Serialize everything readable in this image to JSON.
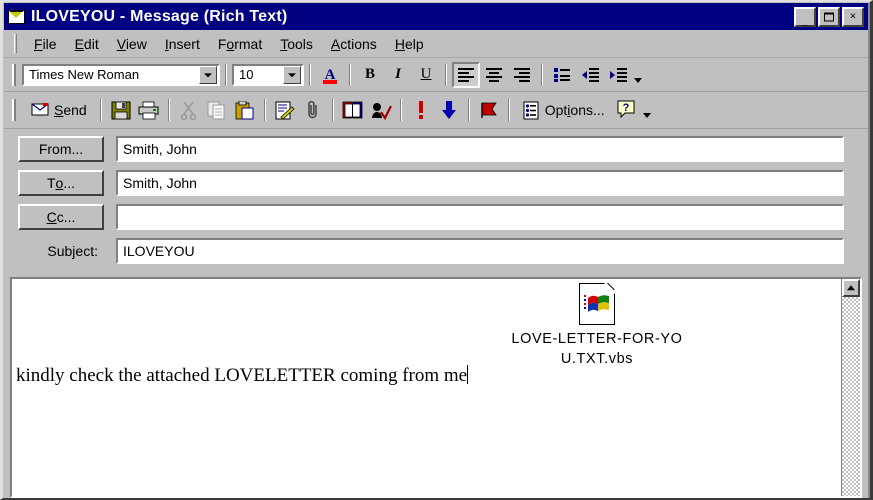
{
  "window": {
    "title": "ILOVEYOU - Message (Rich Text)",
    "icon": "envelope-icon",
    "minimize_label": "_",
    "maximize_label": "",
    "close_label": "×"
  },
  "menu": {
    "items": [
      {
        "label": "File",
        "accel": "F"
      },
      {
        "label": "Edit",
        "accel": "E"
      },
      {
        "label": "View",
        "accel": "V"
      },
      {
        "label": "Insert",
        "accel": "I"
      },
      {
        "label": "Format",
        "accel": "o"
      },
      {
        "label": "Tools",
        "accel": "T"
      },
      {
        "label": "Actions",
        "accel": "A"
      },
      {
        "label": "Help",
        "accel": "H"
      }
    ]
  },
  "formatting_toolbar": {
    "font_name": "Times New Roman",
    "font_size": "10",
    "font_color_label": "A",
    "font_color": "#ff0000",
    "bold_label": "B",
    "italic_label": "I",
    "underline_label": "U",
    "buttons": [
      {
        "name": "font-color-button",
        "icon": "font-color-icon"
      },
      {
        "name": "bold-button",
        "icon": "bold-icon"
      },
      {
        "name": "italic-button",
        "icon": "italic-icon"
      },
      {
        "name": "underline-button",
        "icon": "underline-icon"
      },
      {
        "name": "align-left-button",
        "icon": "align-left-icon"
      },
      {
        "name": "align-center-button",
        "icon": "align-center-icon"
      },
      {
        "name": "align-right-button",
        "icon": "align-right-icon"
      },
      {
        "name": "bullets-button",
        "icon": "bullet-list-icon"
      },
      {
        "name": "decrease-indent-button",
        "icon": "decrease-indent-icon"
      },
      {
        "name": "increase-indent-button",
        "icon": "increase-indent-icon"
      }
    ]
  },
  "standard_toolbar": {
    "send_label": "Send",
    "send_accel": "S",
    "options_label": "Options...",
    "help_label": "?",
    "buttons": [
      {
        "name": "send-button",
        "icon": "envelope-send-icon"
      },
      {
        "name": "save-button",
        "icon": "floppy-disk-icon"
      },
      {
        "name": "print-button",
        "icon": "printer-icon"
      },
      {
        "name": "cut-button",
        "icon": "scissors-icon"
      },
      {
        "name": "copy-button",
        "icon": "copy-icon"
      },
      {
        "name": "paste-button",
        "icon": "clipboard-icon"
      },
      {
        "name": "insert-file-button",
        "icon": "insert-file-icon"
      },
      {
        "name": "attach-button",
        "icon": "paperclip-icon"
      },
      {
        "name": "address-book-button",
        "icon": "address-book-icon"
      },
      {
        "name": "check-names-button",
        "icon": "check-names-icon"
      },
      {
        "name": "importance-high-button",
        "icon": "exclamation-icon"
      },
      {
        "name": "importance-low-button",
        "icon": "down-arrow-icon"
      },
      {
        "name": "flag-button",
        "icon": "flag-icon"
      },
      {
        "name": "options-button",
        "icon": "options-icon"
      },
      {
        "name": "help-button",
        "icon": "question-mark-icon"
      }
    ]
  },
  "header_fields": {
    "from": {
      "button_label": "From...",
      "accel": "",
      "value": "Smith, John"
    },
    "to": {
      "button_label": "To...",
      "accel": "o",
      "value": "Smith, John"
    },
    "cc": {
      "button_label": "Cc...",
      "accel": "C",
      "value": ""
    },
    "subject": {
      "label": "Subject:",
      "accel": "j",
      "value": "ILOVEYOU"
    }
  },
  "message_body": {
    "text": "kindly check the attached LOVELETTER coming from me",
    "attachment": {
      "filename": "LOVE-LETTER-FOR-YOU.TXT.vbs",
      "filename_line1": "LOVE-LETTER-FOR-Y",
      "filename_line2": "OU.TXT.vbs",
      "icon": "vbscript-file-icon"
    }
  },
  "scrollbar": {
    "up_button_label": "scroll-up"
  },
  "colors": {
    "titlebar": "#000080",
    "window_face": "#c0c0c0",
    "field_background": "#ffffff",
    "accent_red": "#ff0000",
    "accent_blue": "#000080"
  }
}
